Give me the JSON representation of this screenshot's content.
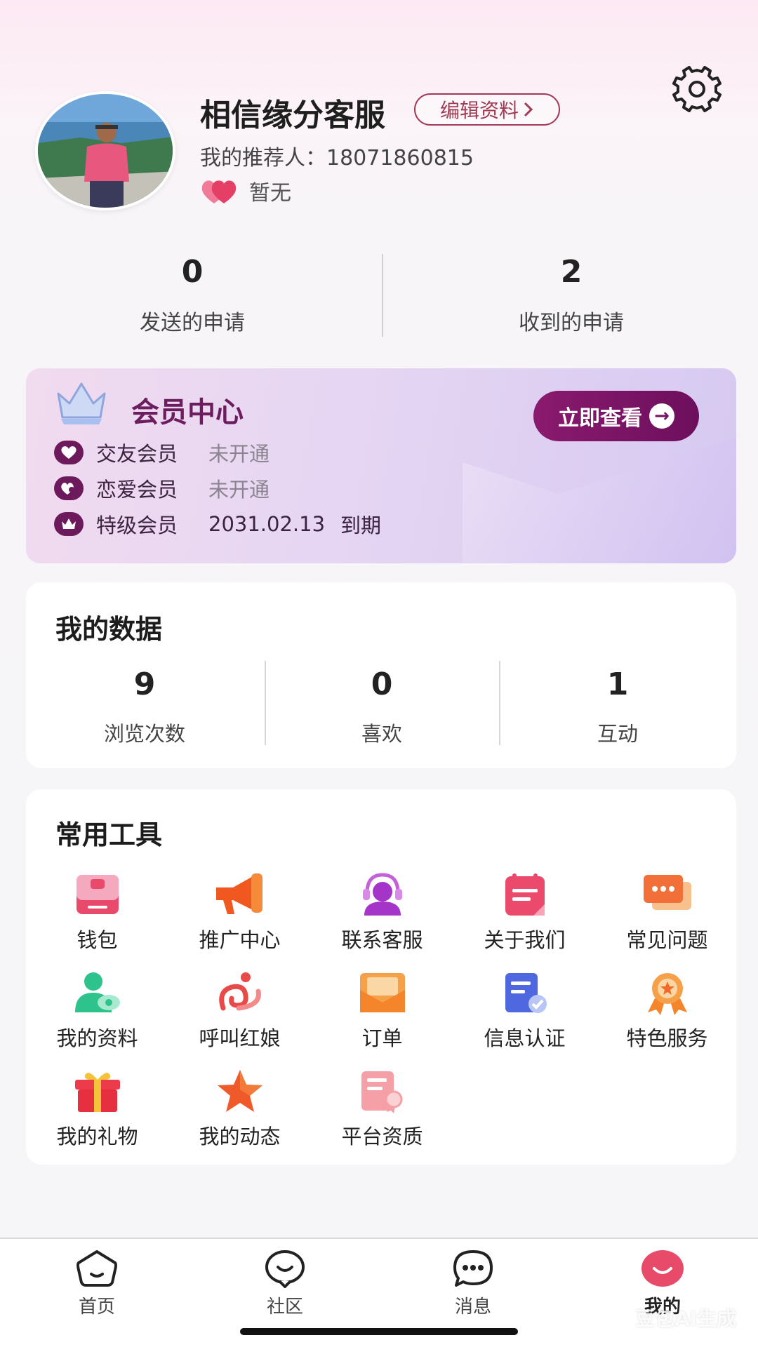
{
  "profile": {
    "username": "相信缘分客服",
    "edit_label": "编辑资料",
    "referrer_label": "我的推荐人：",
    "referrer_value": "18071860815",
    "match_status": "暂无"
  },
  "applications": {
    "sent": {
      "count": "0",
      "label": "发送的申请"
    },
    "received": {
      "count": "2",
      "label": "收到的申请"
    }
  },
  "membership": {
    "title": "会员中心",
    "view_button": "立即查看",
    "rows": [
      {
        "name": "交友会员",
        "state": "未开通"
      },
      {
        "name": "恋爱会员",
        "state": "未开通"
      },
      {
        "name": "特级会员",
        "state": "2031.02.13",
        "suffix": "到期"
      }
    ]
  },
  "my_data": {
    "title": "我的数据",
    "stats": [
      {
        "count": "9",
        "label": "浏览次数"
      },
      {
        "count": "0",
        "label": "喜欢"
      },
      {
        "count": "1",
        "label": "互动"
      }
    ]
  },
  "tools": {
    "title": "常用工具",
    "items": [
      {
        "label": "钱包",
        "icon": "wallet-icon"
      },
      {
        "label": "推广中心",
        "icon": "megaphone-icon"
      },
      {
        "label": "联系客服",
        "icon": "customer-service-icon"
      },
      {
        "label": "关于我们",
        "icon": "notebook-icon"
      },
      {
        "label": "常见问题",
        "icon": "chat-icon"
      },
      {
        "label": "我的资料",
        "icon": "user-profile-icon"
      },
      {
        "label": "呼叫红娘",
        "icon": "matchmaker-icon"
      },
      {
        "label": "订单",
        "icon": "envelope-icon"
      },
      {
        "label": "信息认证",
        "icon": "verified-document-icon"
      },
      {
        "label": "特色服务",
        "icon": "medal-icon"
      },
      {
        "label": "我的礼物",
        "icon": "gift-icon"
      },
      {
        "label": "我的动态",
        "icon": "star-icon"
      },
      {
        "label": "平台资质",
        "icon": "certificate-icon"
      }
    ]
  },
  "tabbar": {
    "items": [
      {
        "label": "首页",
        "icon": "home-icon"
      },
      {
        "label": "社区",
        "icon": "community-icon"
      },
      {
        "label": "消息",
        "icon": "message-icon"
      },
      {
        "label": "我的",
        "icon": "profile-icon",
        "active": true
      }
    ]
  },
  "watermark": "豆包AI生成",
  "colors": {
    "accent": "#6d0f5c",
    "brand_pink": "#e84a6a",
    "member_text": "#6c1d5e"
  }
}
